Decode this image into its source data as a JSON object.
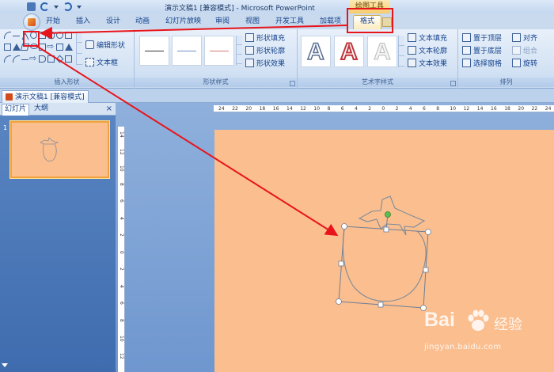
{
  "window": {
    "title": "演示文稿1 [兼容模式] - Microsoft PowerPoint",
    "context_tab_group": "绘图工具"
  },
  "ribbon": {
    "tabs": [
      "开始",
      "插入",
      "设计",
      "动画",
      "幻灯片放映",
      "审阅",
      "视图",
      "开发工具",
      "加载项",
      "格式"
    ],
    "active_tab": "格式",
    "groups": {
      "insert_shapes": {
        "label": "插入形状",
        "edit_shape": "编辑形状",
        "text_box": "文本框"
      },
      "shape_styles": {
        "label": "形状样式",
        "fill": "形状填充",
        "outline": "形状轮廓",
        "effects": "形状效果"
      },
      "wordart_styles": {
        "label": "艺术字样式",
        "sample_letter": "A",
        "text_fill": "文本填充",
        "text_outline": "文本轮廓",
        "text_effects": "文本效果"
      },
      "arrange": {
        "label": "排列",
        "bring_forward": "置于顶层",
        "send_backward": "置于底层",
        "selection_pane": "选择窗格",
        "align": "对齐",
        "group": "组合",
        "rotate": "旋转"
      }
    }
  },
  "document_tab": "演示文稿1 [兼容模式]",
  "slides_panel": {
    "tabs": [
      "幻灯片",
      "大纲"
    ],
    "close": "×",
    "slide_number": "1"
  },
  "rulers": {
    "horizontal": [
      "24",
      "22",
      "20",
      "18",
      "16",
      "14",
      "12",
      "10",
      "8",
      "6",
      "4",
      "2",
      "0",
      "2",
      "4",
      "6",
      "8",
      "10",
      "12",
      "14",
      "16",
      "18",
      "20",
      "22",
      "24"
    ],
    "vertical": [
      "14",
      "12",
      "10",
      "8",
      "6",
      "4",
      "2",
      "0",
      "2",
      "4",
      "6",
      "8",
      "10",
      "12"
    ]
  },
  "watermark": {
    "brand": "Bai",
    "cn": "经验",
    "url": "jingyan.baidu.com"
  },
  "colors": {
    "slide_bg": "#fbbe8f",
    "annotation_red": "#e8141b",
    "ribbon_blue": "#15428b",
    "active_tab_gold": "#f6cc6a"
  },
  "icons": [
    "office-button-icon",
    "save-icon",
    "undo-icon",
    "redo-icon",
    "freeform-scribble-icon",
    "wordart-icon",
    "close-icon"
  ]
}
